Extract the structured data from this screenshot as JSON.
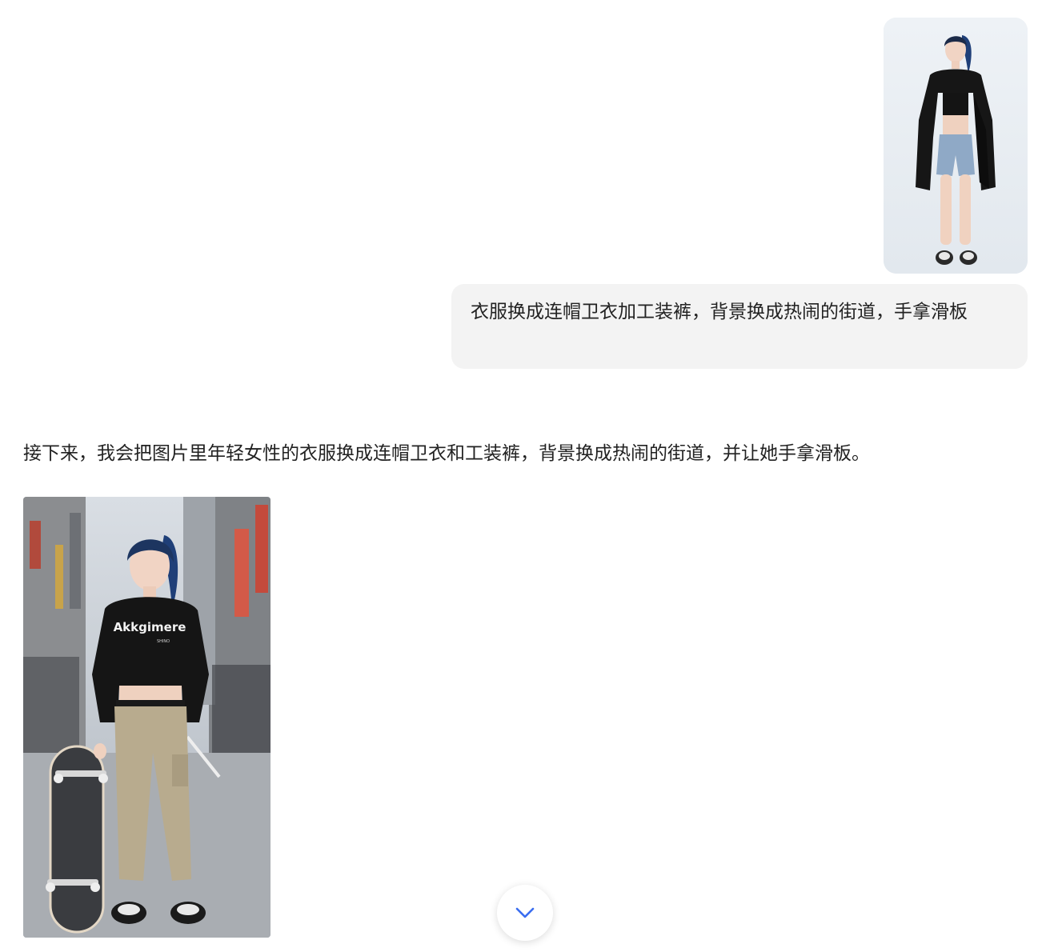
{
  "user_message": {
    "image": {
      "description_icon": "photo-woman-black-coat-denim-shorts"
    },
    "text": "衣服换成连帽卫衣加工装裤，背景换成热闹的街道，手拿滑板"
  },
  "assistant_message": {
    "text": "接下来，我会把图片里年轻女性的衣服换成连帽卫衣和工装裤，背景换成热闹的街道，并让她手拿滑板。",
    "image": {
      "description_icon": "photo-woman-hoodie-cargo-pants-skateboard-street",
      "hoodie_print": "Akkgimere",
      "hoodie_small_print": "SHINO"
    }
  },
  "scroll_button": {
    "icon": "chevron-down-icon"
  },
  "colors": {
    "bubble_bg": "#f3f3f3",
    "accent": "#3a6df0"
  }
}
